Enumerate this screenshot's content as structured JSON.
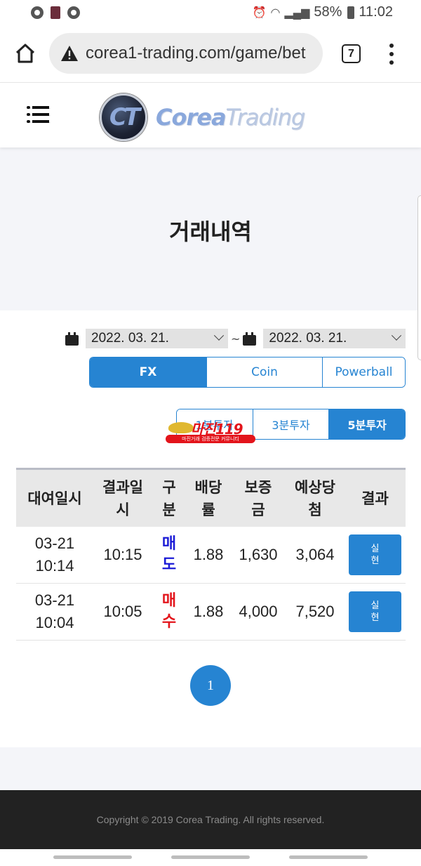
{
  "status_bar": {
    "battery": "58%",
    "time": "11:02",
    "icons": [
      "aperture-icon",
      "book-icon",
      "aperture-icon",
      "alarm-icon",
      "wifi-icon",
      "signal-icon",
      "battery-icon"
    ]
  },
  "browser": {
    "url": "corea1-trading.com/game/bet",
    "tab_count": "7",
    "icons": {
      "home": "home-icon",
      "security": "warning-icon",
      "menu": "more-vert-icon"
    }
  },
  "site": {
    "logo_mark": "CT",
    "logo_bold": "Corea",
    "logo_light": "Trading",
    "menu_icon": "list-menu-icon"
  },
  "page": {
    "title": "거래내역"
  },
  "filters": {
    "start_date": "2022. 03. 21.",
    "end_date": "2022. 03. 21.",
    "separator": "~",
    "categories": [
      {
        "label": "FX",
        "active": true
      },
      {
        "label": "Coin",
        "active": false
      },
      {
        "label": "Powerball",
        "active": false
      }
    ],
    "periods": [
      {
        "label": "1분투자",
        "active": false
      },
      {
        "label": "3분투자",
        "active": false
      },
      {
        "label": "5분투자",
        "active": true
      }
    ]
  },
  "watermark": {
    "title": "마진119",
    "subtitle": "마진거래 검증전문 커뮤니티"
  },
  "table": {
    "headers": [
      "대여일시",
      "결과일\n시",
      "구\n분",
      "배당\n률",
      "보증\n금",
      "예상당\n첨",
      "결과"
    ],
    "rows": [
      {
        "rent_date": "03-21",
        "rent_time": "10:14",
        "result_time": "10:15",
        "kind": "매\n도",
        "kind_color": "#1a1ad6",
        "rate": "1.88",
        "deposit": "1,630",
        "expected": "3,064",
        "result": "실\n현"
      },
      {
        "rent_date": "03-21",
        "rent_time": "10:04",
        "result_time": "10:05",
        "kind": "매\n수",
        "kind_color": "#e3141b",
        "rate": "1.88",
        "deposit": "4,000",
        "expected": "7,520",
        "result": "실\n현"
      }
    ]
  },
  "pagination": {
    "current": "1"
  },
  "footer": {
    "copyright": "Copyright © 2019 Corea Trading. All rights reserved."
  },
  "colors": {
    "accent": "#2684d2",
    "sell": "#1a1ad6",
    "buy": "#e3141b",
    "footer_bg": "#222222"
  }
}
